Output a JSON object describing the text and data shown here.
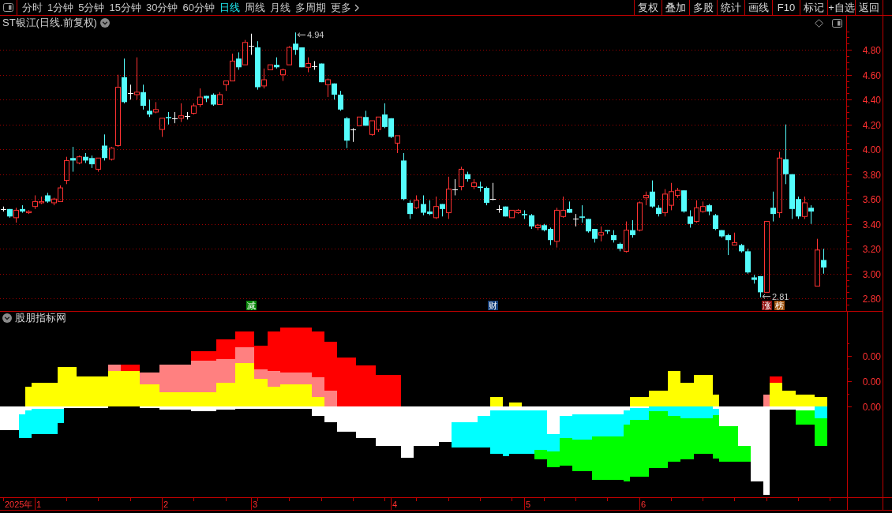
{
  "toolbar": {
    "periods": [
      {
        "label": "分时",
        "selected": false
      },
      {
        "label": "1分钟",
        "selected": false
      },
      {
        "label": "5分钟",
        "selected": false
      },
      {
        "label": "15分钟",
        "selected": false
      },
      {
        "label": "30分钟",
        "selected": false
      },
      {
        "label": "60分钟",
        "selected": false
      },
      {
        "label": "日线",
        "selected": true
      },
      {
        "label": "周线",
        "selected": false
      },
      {
        "label": "月线",
        "selected": false
      },
      {
        "label": "多周期",
        "selected": false
      }
    ],
    "more": "更多",
    "actions": [
      "复权",
      "叠加",
      "多股",
      "统计",
      "画线",
      "F10",
      "标记",
      "+自选",
      "返回"
    ]
  },
  "price_pane": {
    "title": "ST银江(日线.前复权)",
    "chart_data": [
      {
        "type": "candlestick",
        "ylim": [
          2.7,
          4.96
        ],
        "grid": true,
        "yticks": [
          {
            "value": 4.8,
            "label": "4.80"
          },
          {
            "value": 4.6,
            "label": "4.60"
          },
          {
            "value": 4.4,
            "label": "4.40"
          },
          {
            "value": 4.2,
            "label": "4.20"
          },
          {
            "value": 4.0,
            "label": "4.00"
          },
          {
            "value": 3.8,
            "label": "3.80"
          },
          {
            "value": 3.6,
            "label": "3.60"
          },
          {
            "value": 3.4,
            "label": "3.40"
          },
          {
            "value": 3.2,
            "label": "3.20"
          },
          {
            "value": 3.0,
            "label": "3.00"
          },
          {
            "value": 2.8,
            "label": "2.80"
          }
        ],
        "ohlc": [
          [
            3.52,
            3.54,
            3.5,
            3.52
          ],
          [
            3.52,
            3.52,
            3.45,
            3.46
          ],
          [
            3.45,
            3.53,
            3.41,
            3.51
          ],
          [
            3.52,
            3.55,
            3.49,
            3.5
          ],
          [
            3.49,
            3.51,
            3.48,
            3.5
          ],
          [
            3.54,
            3.63,
            3.52,
            3.58
          ],
          [
            3.57,
            3.62,
            3.56,
            3.58
          ],
          [
            3.63,
            3.65,
            3.57,
            3.58
          ],
          [
            3.57,
            3.61,
            3.55,
            3.6
          ],
          [
            3.58,
            3.71,
            3.58,
            3.69
          ],
          [
            3.75,
            3.94,
            3.72,
            3.91
          ],
          [
            3.93,
            4.02,
            3.82,
            3.91
          ],
          [
            3.89,
            3.95,
            3.88,
            3.94
          ],
          [
            3.94,
            3.97,
            3.89,
            3.91
          ],
          [
            3.93,
            3.95,
            3.85,
            3.88
          ],
          [
            3.84,
            3.93,
            3.82,
            3.93
          ],
          [
            4.03,
            4.12,
            3.91,
            3.93
          ],
          [
            3.92,
            4.02,
            3.91,
            4.01
          ],
          [
            4.03,
            4.6,
            4.02,
            4.5
          ],
          [
            4.58,
            4.73,
            4.37,
            4.38
          ],
          [
            4.45,
            4.52,
            4.4,
            4.45
          ],
          [
            4.44,
            4.74,
            4.4,
            4.46
          ],
          [
            4.46,
            4.52,
            4.32,
            4.35
          ],
          [
            4.31,
            4.4,
            4.26,
            4.28
          ],
          [
            4.3,
            4.38,
            4.29,
            4.32
          ],
          [
            4.16,
            4.25,
            4.1,
            4.25
          ],
          [
            4.26,
            4.3,
            4.2,
            4.25
          ],
          [
            4.25,
            4.3,
            4.21,
            4.25
          ],
          [
            4.25,
            4.37,
            4.22,
            4.27
          ],
          [
            4.27,
            4.3,
            4.24,
            4.27
          ],
          [
            4.29,
            4.37,
            4.28,
            4.35
          ],
          [
            4.36,
            4.49,
            4.34,
            4.42
          ],
          [
            4.43,
            4.43,
            4.38,
            4.41
          ],
          [
            4.44,
            4.45,
            4.35,
            4.36
          ],
          [
            4.36,
            4.46,
            4.36,
            4.44
          ],
          [
            4.52,
            4.55,
            4.47,
            4.55
          ],
          [
            4.55,
            4.77,
            4.55,
            4.71
          ],
          [
            4.73,
            4.78,
            4.64,
            4.66
          ],
          [
            4.68,
            4.88,
            4.68,
            4.86
          ],
          [
            4.83,
            4.93,
            4.76,
            4.83
          ],
          [
            4.82,
            4.87,
            4.48,
            4.5
          ],
          [
            4.51,
            4.65,
            4.49,
            4.56
          ],
          [
            4.64,
            4.68,
            4.64,
            4.68
          ],
          [
            4.68,
            4.74,
            4.65,
            4.66
          ],
          [
            4.6,
            4.65,
            4.55,
            4.64
          ],
          [
            4.68,
            4.83,
            4.68,
            4.82
          ],
          [
            4.85,
            4.94,
            4.76,
            4.8
          ],
          [
            4.82,
            4.82,
            4.66,
            4.66
          ],
          [
            4.66,
            4.74,
            4.62,
            4.69
          ],
          [
            4.67,
            4.71,
            4.64,
            4.67
          ],
          [
            4.69,
            4.69,
            4.54,
            4.54
          ],
          [
            4.52,
            4.57,
            4.42,
            4.56
          ],
          [
            4.53,
            4.53,
            4.4,
            4.44
          ],
          [
            4.44,
            4.47,
            4.31,
            4.32
          ],
          [
            4.25,
            4.26,
            4.01,
            4.07
          ],
          [
            4.16,
            4.17,
            4.06,
            4.16
          ],
          [
            4.19,
            4.26,
            4.19,
            4.26
          ],
          [
            4.26,
            4.31,
            4.19,
            4.19
          ],
          [
            4.12,
            4.23,
            4.11,
            4.23
          ],
          [
            4.16,
            4.26,
            4.14,
            4.26
          ],
          [
            4.28,
            4.37,
            4.17,
            4.18
          ],
          [
            4.25,
            4.25,
            4.09,
            4.1
          ],
          [
            4.05,
            4.11,
            3.97,
            4.11
          ],
          [
            3.91,
            3.97,
            3.59,
            3.6
          ],
          [
            3.57,
            3.59,
            3.44,
            3.48
          ],
          [
            3.53,
            3.63,
            3.52,
            3.59
          ],
          [
            3.56,
            3.63,
            3.47,
            3.49
          ],
          [
            3.5,
            3.59,
            3.47,
            3.48
          ],
          [
            3.45,
            3.62,
            3.44,
            3.54
          ],
          [
            3.56,
            3.56,
            3.46,
            3.52
          ],
          [
            3.49,
            3.78,
            3.44,
            3.68
          ],
          [
            3.68,
            3.76,
            3.63,
            3.68
          ],
          [
            3.7,
            3.86,
            3.67,
            3.84
          ],
          [
            3.8,
            3.82,
            3.74,
            3.76
          ],
          [
            3.7,
            3.76,
            3.68,
            3.73
          ],
          [
            3.7,
            3.74,
            3.66,
            3.69
          ],
          [
            3.69,
            3.7,
            3.55,
            3.57
          ],
          [
            3.6,
            3.73,
            3.59,
            3.6
          ],
          [
            3.52,
            3.55,
            3.49,
            3.52
          ],
          [
            3.54,
            3.54,
            3.46,
            3.46
          ],
          [
            3.45,
            3.51,
            3.45,
            3.51
          ],
          [
            3.49,
            3.52,
            3.48,
            3.51
          ],
          [
            3.48,
            3.51,
            3.44,
            3.47
          ],
          [
            3.47,
            3.48,
            3.36,
            3.38
          ],
          [
            3.37,
            3.4,
            3.35,
            3.39
          ],
          [
            3.39,
            3.4,
            3.34,
            3.35
          ],
          [
            3.36,
            3.37,
            3.23,
            3.27
          ],
          [
            3.26,
            3.53,
            3.21,
            3.51
          ],
          [
            3.46,
            3.62,
            3.45,
            3.51
          ],
          [
            3.52,
            3.58,
            3.49,
            3.49
          ],
          [
            3.44,
            3.48,
            3.38,
            3.44
          ],
          [
            3.46,
            3.55,
            3.41,
            3.45
          ],
          [
            3.44,
            3.44,
            3.33,
            3.34
          ],
          [
            3.36,
            3.36,
            3.25,
            3.28
          ],
          [
            3.31,
            3.38,
            3.26,
            3.33
          ],
          [
            3.35,
            3.35,
            3.32,
            3.34
          ],
          [
            3.31,
            3.35,
            3.25,
            3.27
          ],
          [
            3.24,
            3.25,
            3.18,
            3.2
          ],
          [
            3.18,
            3.42,
            3.17,
            3.35
          ],
          [
            3.35,
            3.43,
            3.29,
            3.31
          ],
          [
            3.35,
            3.58,
            3.34,
            3.57
          ],
          [
            3.61,
            3.66,
            3.55,
            3.63
          ],
          [
            3.66,
            3.75,
            3.53,
            3.54
          ],
          [
            3.53,
            3.55,
            3.46,
            3.48
          ],
          [
            3.49,
            3.68,
            3.46,
            3.64
          ],
          [
            3.55,
            3.73,
            3.51,
            3.66
          ],
          [
            3.63,
            3.69,
            3.61,
            3.67
          ],
          [
            3.67,
            3.67,
            3.49,
            3.5
          ],
          [
            3.46,
            3.51,
            3.37,
            3.4
          ],
          [
            3.42,
            3.59,
            3.41,
            3.53
          ],
          [
            3.5,
            3.58,
            3.49,
            3.54
          ],
          [
            3.55,
            3.56,
            3.47,
            3.5
          ],
          [
            3.47,
            3.48,
            3.35,
            3.36
          ],
          [
            3.35,
            3.35,
            3.29,
            3.3
          ],
          [
            3.31,
            3.32,
            3.15,
            3.27
          ],
          [
            3.23,
            3.33,
            3.23,
            3.25
          ],
          [
            3.23,
            3.24,
            3.17,
            3.18
          ],
          [
            3.18,
            3.2,
            3.0,
            3.01
          ],
          [
            2.97,
            2.99,
            2.92,
            2.95
          ],
          [
            2.98,
            2.98,
            2.81,
            2.85
          ],
          [
            2.85,
            3.42,
            2.85,
            3.42
          ],
          [
            3.53,
            3.66,
            3.42,
            3.48
          ],
          [
            3.49,
            3.98,
            3.45,
            3.93
          ],
          [
            3.92,
            4.2,
            3.72,
            3.8
          ],
          [
            3.8,
            3.8,
            3.44,
            3.52
          ],
          [
            3.6,
            3.62,
            3.44,
            3.46
          ],
          [
            3.46,
            3.62,
            3.44,
            3.57
          ],
          [
            3.53,
            3.55,
            3.4,
            3.5
          ],
          [
            2.9,
            3.28,
            2.9,
            3.19
          ],
          [
            3.11,
            3.2,
            3.0,
            3.05
          ],
          null,
          null,
          null
        ],
        "annotations": [
          "4.94",
          "2.81"
        ]
      }
    ],
    "event_tags": [
      {
        "label": "减",
        "color": "#0a8a0a"
      },
      {
        "label": "财",
        "color": "#17407a"
      },
      {
        "label": "涨",
        "color": "#901010"
      },
      {
        "label": "榜",
        "color": "#a0520d"
      }
    ]
  },
  "indicator_pane": {
    "title": "股朋指标网",
    "axis_labels": [
      "0.00",
      "0.00",
      "0.00"
    ]
  },
  "time_axis": {
    "labels": [
      "2025年",
      "1",
      "2",
      "3",
      "4",
      "5",
      "6"
    ]
  }
}
